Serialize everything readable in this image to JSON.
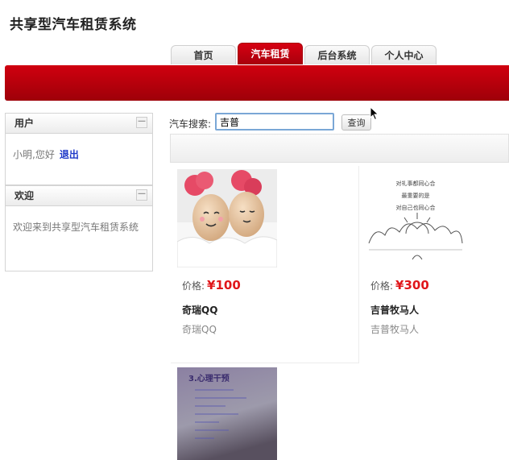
{
  "site": {
    "title": "共享型汽车租赁系统"
  },
  "nav": {
    "tabs": [
      {
        "label": "首页",
        "active": false
      },
      {
        "label": "汽车租赁",
        "active": true
      },
      {
        "label": "后台系统",
        "active": false
      },
      {
        "label": "个人中心",
        "active": false
      }
    ]
  },
  "colors": {
    "brand": "#c00010",
    "price": "#e0161a",
    "link": "#1f39c8"
  },
  "sidebar": {
    "user_panel": {
      "title": "用户",
      "collapse_symbol": "—",
      "greeting": "小明,您好",
      "logout": "退出"
    },
    "welcome_panel": {
      "title": "欢迎",
      "collapse_symbol": "—",
      "message": "欢迎来到共享型汽车租赁系统"
    }
  },
  "search": {
    "label": "汽车搜索:",
    "value": "吉普",
    "button": "查询"
  },
  "cars": [
    {
      "price_label": "价格:",
      "currency": "¥",
      "price": "100",
      "name": "奇瑞QQ",
      "subtitle": "奇瑞QQ",
      "image": "eggs-photo"
    },
    {
      "price_label": "价格:",
      "currency": "¥",
      "price": "300",
      "name": "吉普牧马人",
      "subtitle": "吉普牧马人",
      "image": "sketch-drawing",
      "image_text": [
        "对礼事都同心合",
        "最重要的是",
        "对自己也同心合"
      ]
    },
    {
      "image": "document-photo",
      "image_heading": "3.心理干预"
    }
  ]
}
